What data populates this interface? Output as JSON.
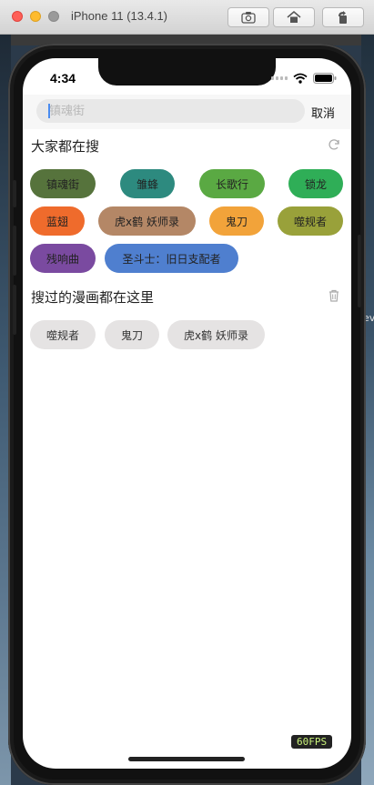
{
  "window": {
    "title": "iPhone 11 (13.4.1)"
  },
  "status": {
    "time": "4:34"
  },
  "search": {
    "placeholder": "镇魂街",
    "cancel_label": "取消"
  },
  "hot": {
    "title": "大家都在搜",
    "tags": [
      {
        "label": "镇魂街",
        "color": "#56733c"
      },
      {
        "label": "雏蜂",
        "color": "#2d8a7f"
      },
      {
        "label": "长歌行",
        "color": "#5aa943"
      },
      {
        "label": "锁龙",
        "color": "#2fae57"
      },
      {
        "label": "蓝翅",
        "color": "#ef6b2c"
      },
      {
        "label": "虎x鹤 妖师录",
        "color": "#b48766"
      },
      {
        "label": "鬼刀",
        "color": "#f2a33a"
      },
      {
        "label": "噬规者",
        "color": "#99a13a"
      },
      {
        "label": "残响曲",
        "color": "#7a4aa0"
      },
      {
        "label": "圣斗士：旧日支配者",
        "color": "#4f7fcf"
      }
    ]
  },
  "history": {
    "title": "搜过的漫画都在这里",
    "items": [
      "噬规者",
      "鬼刀",
      "虎x鹤 妖师录"
    ]
  },
  "fps": "60FPS",
  "desktop_peek": "ev"
}
